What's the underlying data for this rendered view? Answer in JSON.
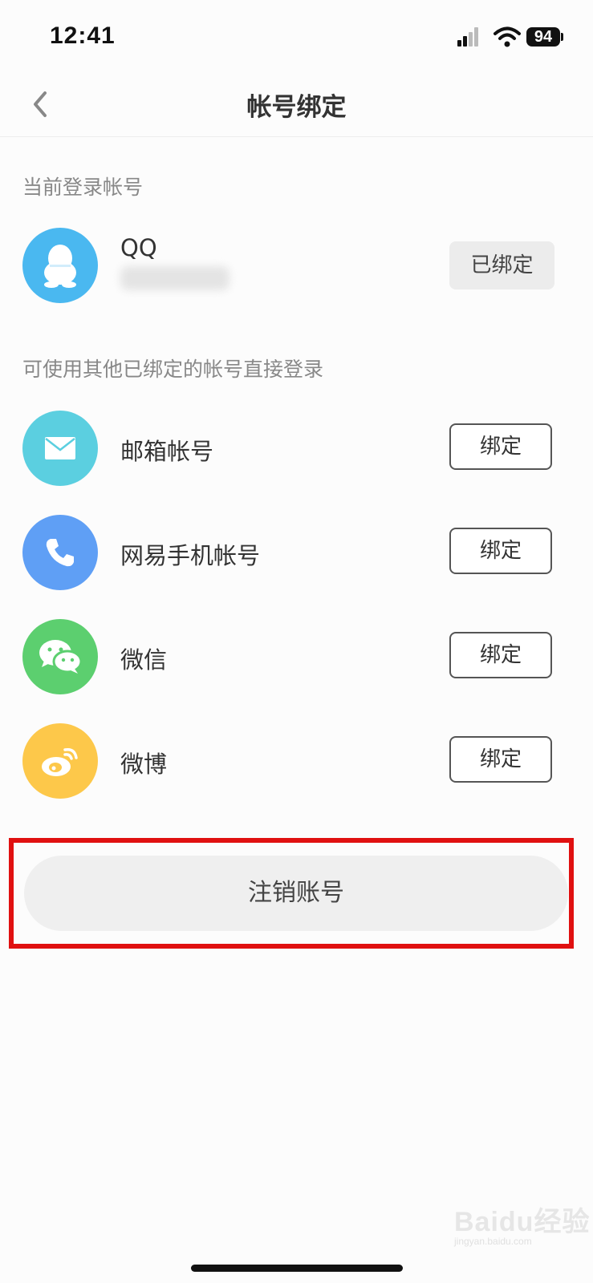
{
  "status_bar": {
    "time": "12:41",
    "battery": "94"
  },
  "nav": {
    "title": "帐号绑定"
  },
  "current_section": {
    "label": "当前登录帐号",
    "account": {
      "name": "QQ",
      "status": "已绑定",
      "icon": "qq-penguin-icon",
      "color": "#4ab8f0"
    }
  },
  "other_section": {
    "label": "可使用其他已绑定的帐号直接登录",
    "items": [
      {
        "label": "邮箱帐号",
        "button": "绑定",
        "icon": "mail-icon",
        "color": "#5bcfe0"
      },
      {
        "label": "网易手机帐号",
        "button": "绑定",
        "icon": "phone-icon",
        "color": "#5f9ff5"
      },
      {
        "label": "微信",
        "button": "绑定",
        "icon": "wechat-icon",
        "color": "#5ccf6f"
      },
      {
        "label": "微博",
        "button": "绑定",
        "icon": "weibo-icon",
        "color": "#fdc84a"
      }
    ]
  },
  "logout": {
    "label": "注销账号"
  },
  "watermark": {
    "text": "Baidu经验",
    "sub": "jingyan.baidu.com"
  }
}
